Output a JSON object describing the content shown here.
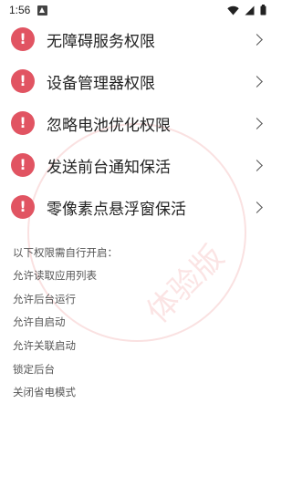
{
  "status_bar": {
    "time": "1:56",
    "notification_icon": "notification-icon",
    "wifi_icon": "wifi-icon",
    "signal_icon": "signal-icon",
    "battery_icon": "battery-icon"
  },
  "permissions": [
    {
      "label": "无障碍服务权限",
      "icon": "warning-icon",
      "status_color": "#e15462"
    },
    {
      "label": "设备管理器权限",
      "icon": "warning-icon",
      "status_color": "#e15462"
    },
    {
      "label": "忽略电池优化权限",
      "icon": "warning-icon",
      "status_color": "#e15462"
    },
    {
      "label": "发送前台通知保活",
      "icon": "warning-icon",
      "status_color": "#e15462"
    },
    {
      "label": "零像素点悬浮窗保活",
      "icon": "warning-icon",
      "status_color": "#e15462"
    }
  ],
  "warning_glyph": "!",
  "notes": {
    "title": "以下权限需自行开启：",
    "lines": [
      "允许读取应用列表",
      "允许后台运行",
      "允许自启动",
      "允许关联启动",
      "锁定后台",
      "关闭省电模式"
    ]
  },
  "watermark": {
    "text": "体验版",
    "color": "#e65a5a"
  }
}
